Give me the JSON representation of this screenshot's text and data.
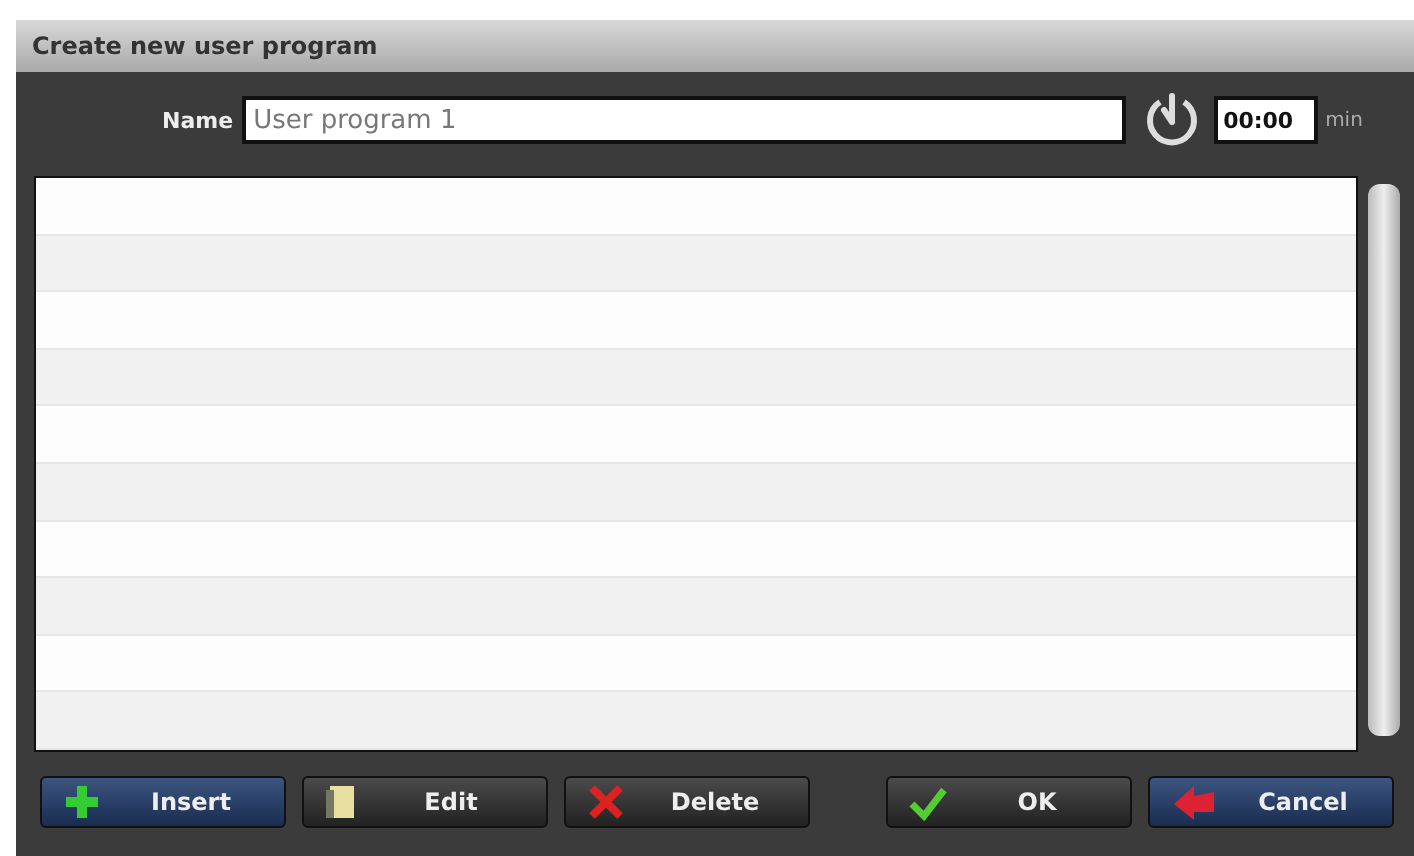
{
  "window": {
    "title": "Create new user program"
  },
  "name_field": {
    "label": "Name",
    "value": "User program 1"
  },
  "duration": {
    "value": "00:00",
    "unit": "min"
  },
  "buttons": [
    {
      "label": "Insert",
      "kind": "insert",
      "highlighted": true
    },
    {
      "label": "Edit",
      "kind": "edit",
      "highlighted": false
    },
    {
      "label": "Delete",
      "kind": "delete",
      "highlighted": false
    },
    {
      "label": "OK",
      "kind": "ok",
      "highlighted": false
    },
    {
      "label": "Cancel",
      "kind": "cancel",
      "highlighted": true
    }
  ]
}
